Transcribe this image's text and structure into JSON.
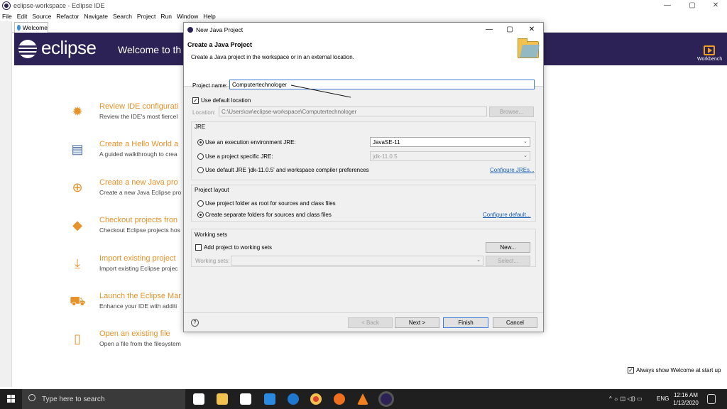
{
  "window": {
    "title": "eclipse-workspace - Eclipse IDE",
    "minimize": "—",
    "maximize": "▢",
    "close": "✕"
  },
  "menu": [
    "File",
    "Edit",
    "Source",
    "Refactor",
    "Navigate",
    "Search",
    "Project",
    "Run",
    "Window",
    "Help"
  ],
  "welcome_tab": {
    "label": "Welcome"
  },
  "header": {
    "brand": "eclipse",
    "title": "Welcome to th",
    "workbench": "Workbench"
  },
  "items": [
    {
      "title": "Review IDE configurati",
      "desc": "Review the IDE's most fiercel",
      "icon": "gear-icon"
    },
    {
      "title": "Create a Hello World a",
      "desc": "A guided walkthrough to crea",
      "icon": "tutorial-icon"
    },
    {
      "title": "Create a new Java pro",
      "desc": "Create a new Java Eclipse pro",
      "icon": "plus-icon"
    },
    {
      "title": "Checkout projects fron",
      "desc": "Checkout Eclipse projects hos",
      "icon": "git-icon"
    },
    {
      "title": "Import existing project",
      "desc": "Import existing Eclipse projec",
      "icon": "import-icon"
    },
    {
      "title": "Launch the Eclipse Mar",
      "desc": "Enhance your IDE with additi",
      "icon": "marketplace-icon"
    },
    {
      "title": "Open an existing file",
      "desc": "Open a file from the filesystem",
      "icon": "file-icon"
    }
  ],
  "always_show": {
    "label": "Always show Welcome at start up",
    "checked": true
  },
  "dialog": {
    "title": "New Java Project",
    "heading": "Create a Java Project",
    "subheading": "Create a Java project in the workspace or in an external location.",
    "project_name_label": "Project name:",
    "project_name_value": "Computertechnologer",
    "use_default_location": "Use default location",
    "location_label": "Location:",
    "location_value": "C:\\Users\\cw\\eclipse-workspace\\Computertechnologer",
    "browse": "Browse...",
    "jre_group": "JRE",
    "jre_opt1": "Use an execution environment JRE:",
    "jre_opt1_value": "JavaSE-11",
    "jre_opt2": "Use a project specific JRE:",
    "jre_opt2_value": "jdk-11.0.5",
    "jre_opt3": "Use default JRE 'jdk-11.0.5' and workspace compiler preferences",
    "configure_jres": "Configure JREs...",
    "layout_group": "Project layout",
    "layout_opt1": "Use project folder as root for sources and class files",
    "layout_opt2": "Create separate folders for sources and class files",
    "configure_default": "Configure default...",
    "ws_group": "Working sets",
    "add_to_ws": "Add project to working sets",
    "new_btn": "New...",
    "ws_label": "Working sets:",
    "select_btn": "Select...",
    "help": "?",
    "back": "< Back",
    "next": "Next >",
    "finish": "Finish",
    "cancel": "Cancel"
  },
  "taskbar": {
    "search": "Type here to search",
    "lang": "ENG",
    "time": "12:16 AM",
    "date": "1/12/2020"
  }
}
